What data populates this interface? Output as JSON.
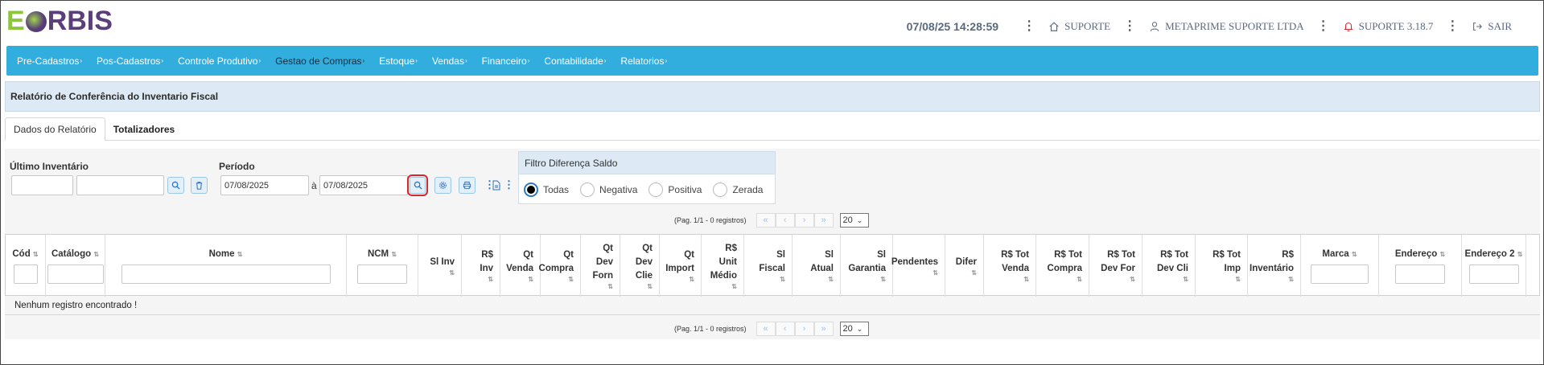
{
  "logo": {
    "part1": "E",
    "part2": "RBIS"
  },
  "header": {
    "datetime": "07/08/25 14:28:59",
    "support": "SUPORTE",
    "company": "METAPRIME SUPORTE LTDA",
    "version": "SUPORTE 3.18.7",
    "logout": "SAIR"
  },
  "menu": [
    {
      "label": "Pre-Cadastros"
    },
    {
      "label": "Pos-Cadastros"
    },
    {
      "label": "Controle Produtivo"
    },
    {
      "label": "Gestao de Compras"
    },
    {
      "label": "Estoque"
    },
    {
      "label": "Vendas"
    },
    {
      "label": "Financeiro"
    },
    {
      "label": "Contabilidade"
    },
    {
      "label": "Relatorios"
    }
  ],
  "page_title": "Relatório de Conferência do Inventario Fiscal",
  "tabs": [
    {
      "label": "Dados do Relatório"
    },
    {
      "label": "Totalizadores"
    }
  ],
  "filters": {
    "ultimo_inventario_label": "Último Inventário",
    "ultimo_inventario_code": "",
    "ultimo_inventario_desc": "",
    "periodo_label": "Período",
    "periodo_start": "07/08/2025",
    "periodo_sep": "à",
    "periodo_end": "07/08/2025",
    "saldo_label": "Filtro Diferença Saldo",
    "saldo_options": [
      "Todas",
      "Negativa",
      "Positiva",
      "Zerada"
    ],
    "saldo_selected": "Todas"
  },
  "pager": {
    "info": "(Pag. 1/1 - 0 registros)",
    "first": "«",
    "prev": "‹",
    "next": "›",
    "last": "»",
    "page_size": "20"
  },
  "table": {
    "columns": [
      {
        "l1": "Cód"
      },
      {
        "l1": "Catálogo"
      },
      {
        "l1": "Nome"
      },
      {
        "l1": "NCM"
      },
      {
        "l1": "Sl Inv"
      },
      {
        "l1": "R$",
        "l2": "Inv"
      },
      {
        "l1": "Qt",
        "l2": "Venda"
      },
      {
        "l1": "Qt",
        "l2": "Compra"
      },
      {
        "l1": "Qt",
        "l2": "Dev",
        "l3": "Forn"
      },
      {
        "l1": "Qt",
        "l2": "Dev",
        "l3": "Clie"
      },
      {
        "l1": "Qt",
        "l2": "Import"
      },
      {
        "l1": "R$",
        "l2": "Unit",
        "l3": "Médio"
      },
      {
        "l1": "Sl",
        "l2": "Fiscal"
      },
      {
        "l1": "Sl",
        "l2": "Atual"
      },
      {
        "l1": "Sl",
        "l2": "Garantia"
      },
      {
        "l1": "Pendentes"
      },
      {
        "l1": "Difer"
      },
      {
        "l1": "R$ Tot",
        "l2": "Venda"
      },
      {
        "l1": "R$ Tot",
        "l2": "Compra"
      },
      {
        "l1": "R$ Tot",
        "l2": "Dev For"
      },
      {
        "l1": "R$ Tot",
        "l2": "Dev Cli"
      },
      {
        "l1": "R$ Tot",
        "l2": "Imp"
      },
      {
        "l1": "R$",
        "l2": "Inventário"
      },
      {
        "l1": "Marca"
      },
      {
        "l1": "Endereço"
      },
      {
        "l1": "Endereço 2"
      }
    ],
    "empty_message": "Nenhum registro encontrado !"
  },
  "colors": {
    "menu_bg": "#31aedd",
    "title_bg": "#dde9f4",
    "highlight": "#d9262a"
  }
}
